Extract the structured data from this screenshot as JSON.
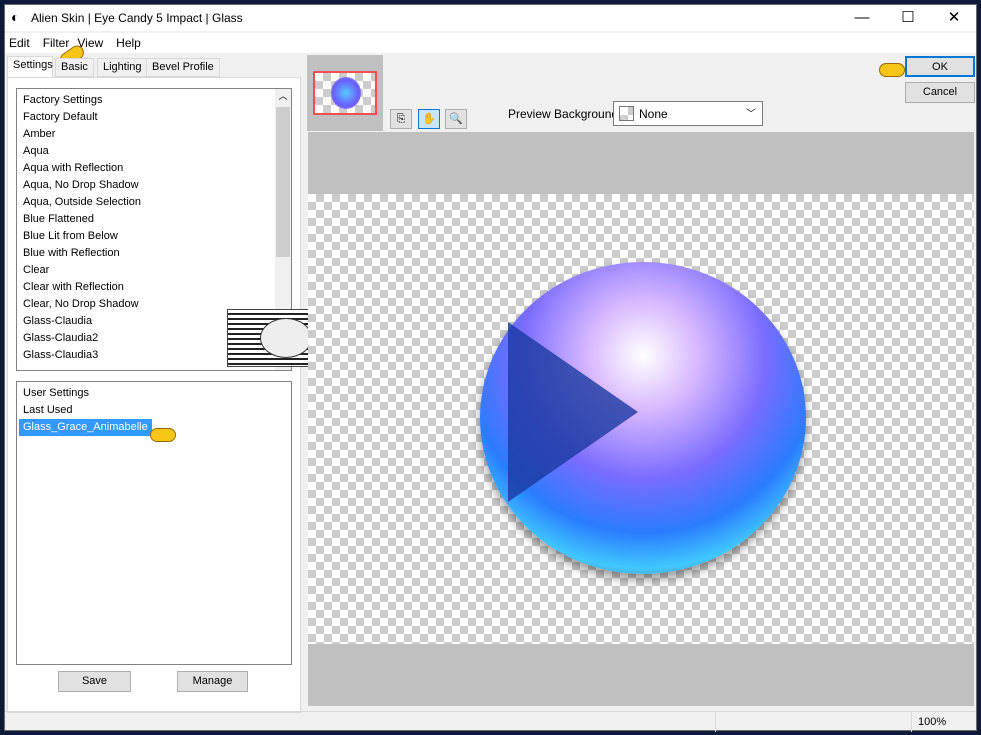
{
  "window": {
    "title": "Alien Skin | Eye Candy 5 Impact | Glass",
    "minimize": "—",
    "maximize": "☐",
    "close": "✕"
  },
  "menu": [
    "Edit",
    "Filter",
    "View",
    "Help"
  ],
  "tabs": [
    "Settings",
    "Basic",
    "Lighting",
    "Bevel Profile"
  ],
  "factory": {
    "header": "Factory Settings",
    "items": [
      "Factory Default",
      "Amber",
      "Aqua",
      "Aqua with Reflection",
      "Aqua, No Drop Shadow",
      "Aqua, Outside Selection",
      "Blue Flattened",
      "Blue Lit from Below",
      "Blue with Reflection",
      "Clear",
      "Clear with Reflection",
      "Clear, No Drop Shadow",
      "Glass-Claudia",
      "Glass-Claudia2",
      "Glass-Claudia3"
    ]
  },
  "user": {
    "header": "User Settings",
    "items": [
      "Last Used",
      "Glass_Grace_Animabelle"
    ],
    "selected": "Glass_Grace_Animabelle"
  },
  "buttons": {
    "save": "Save",
    "manage": "Manage",
    "ok": "OK",
    "cancel": "Cancel"
  },
  "preview": {
    "background_label": "Preview Background:",
    "background_value": "None"
  },
  "watermark": "claudia",
  "status": {
    "zoom": "100%"
  },
  "colors": {
    "selection": "#3399ff",
    "ok_border": "#0078d7",
    "preview_gray": "#c0c0c0"
  }
}
